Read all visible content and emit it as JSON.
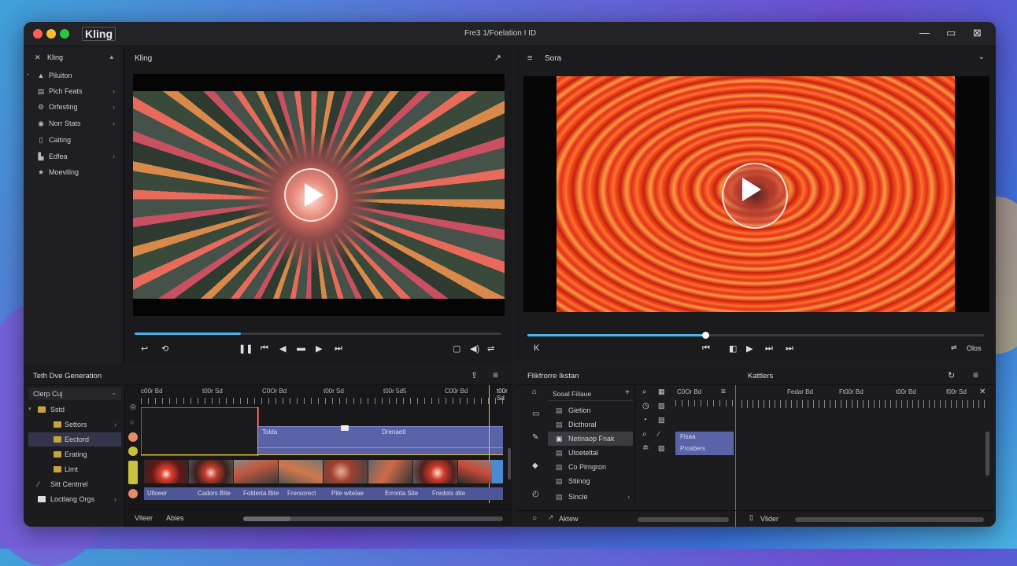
{
  "window": {
    "app_name": "Kling",
    "title": "Fre3 1/Foelation I ID",
    "controls": [
      "minimize-icon",
      "restore-icon",
      "close-icon"
    ]
  },
  "sidebar": {
    "header": "Kling",
    "items": [
      {
        "label": "Piluiton",
        "icon": "chart-icon",
        "arrow": ""
      },
      {
        "label": "Pich Feats",
        "icon": "film-icon",
        "arrow": "›"
      },
      {
        "label": "Orfesting",
        "icon": "gear-icon",
        "arrow": "›"
      },
      {
        "label": "Norr Stats",
        "icon": "globe-icon",
        "arrow": "›"
      },
      {
        "label": "Caiting",
        "icon": "document-icon",
        "arrow": ""
      },
      {
        "label": "Edfea",
        "icon": "chart-icon",
        "arrow": "›"
      },
      {
        "label": "Moeviling",
        "icon": "star-icon",
        "arrow": ""
      }
    ]
  },
  "left_viewer": {
    "title": "Kling",
    "progress_fraction": 0.29
  },
  "right_viewer": {
    "title": "Sora",
    "progress_fraction": 0.39,
    "ctl_right": "Olos"
  },
  "bottom_left": {
    "title": "Teth Dve Generation",
    "dropdown": "Clerp Cuj",
    "tree": [
      {
        "label": "Sstd",
        "level": 0
      },
      {
        "label": "Settors",
        "level": 1,
        "arrow": "›"
      },
      {
        "label": "Eectord",
        "level": 1,
        "selected": true
      },
      {
        "label": "Erating",
        "level": 1
      },
      {
        "label": "Limt",
        "level": 1
      }
    ],
    "footer_items": [
      {
        "label": "Sitt Centrrel",
        "icon": "wand-icon"
      },
      {
        "label": "Loctlang Orgs",
        "icon": "folder-icon",
        "arrow": "›"
      }
    ],
    "ruler_labels": [
      "c00r Bd",
      "t00r Sd",
      "C0Or Bd",
      "t00r Sd",
      "t00r 5d5",
      "C00r Bd",
      "t00r Sd"
    ],
    "clip_labels": [
      "Tolda",
      "Drenaetl"
    ],
    "captions": [
      "Ulloeer",
      "Cadors Bite",
      "Folderta Bite",
      "Frersorect",
      "Pite witelae",
      "Erronta Site",
      "Fredots dite"
    ],
    "footer_left": "Vlleer",
    "footer_right": "Abies"
  },
  "bottom_mid": {
    "title": "Flikfrorre Ikstan",
    "list_header": "Sooal Fiilaue",
    "items": [
      {
        "label": "Gietion"
      },
      {
        "label": "Dicthoral"
      },
      {
        "label": "Netinaop Fnak",
        "selected": true
      },
      {
        "label": "Utoeteltal"
      },
      {
        "label": "Co Pirngron"
      },
      {
        "label": "Stiinog"
      },
      {
        "label": "Sincle",
        "arrow": "›"
      }
    ],
    "footer": "Aktew",
    "ruler_labels": [
      "C0Or Bd"
    ],
    "clip_labels": [
      "Fisaa",
      "Prosbers"
    ]
  },
  "bottom_right": {
    "title": "Kattlers",
    "ruler_labels": [
      "Fedar Bd",
      "Ft00r Bd",
      "t00r Bd",
      "f00r Sd"
    ],
    "footer": "Vlider"
  }
}
